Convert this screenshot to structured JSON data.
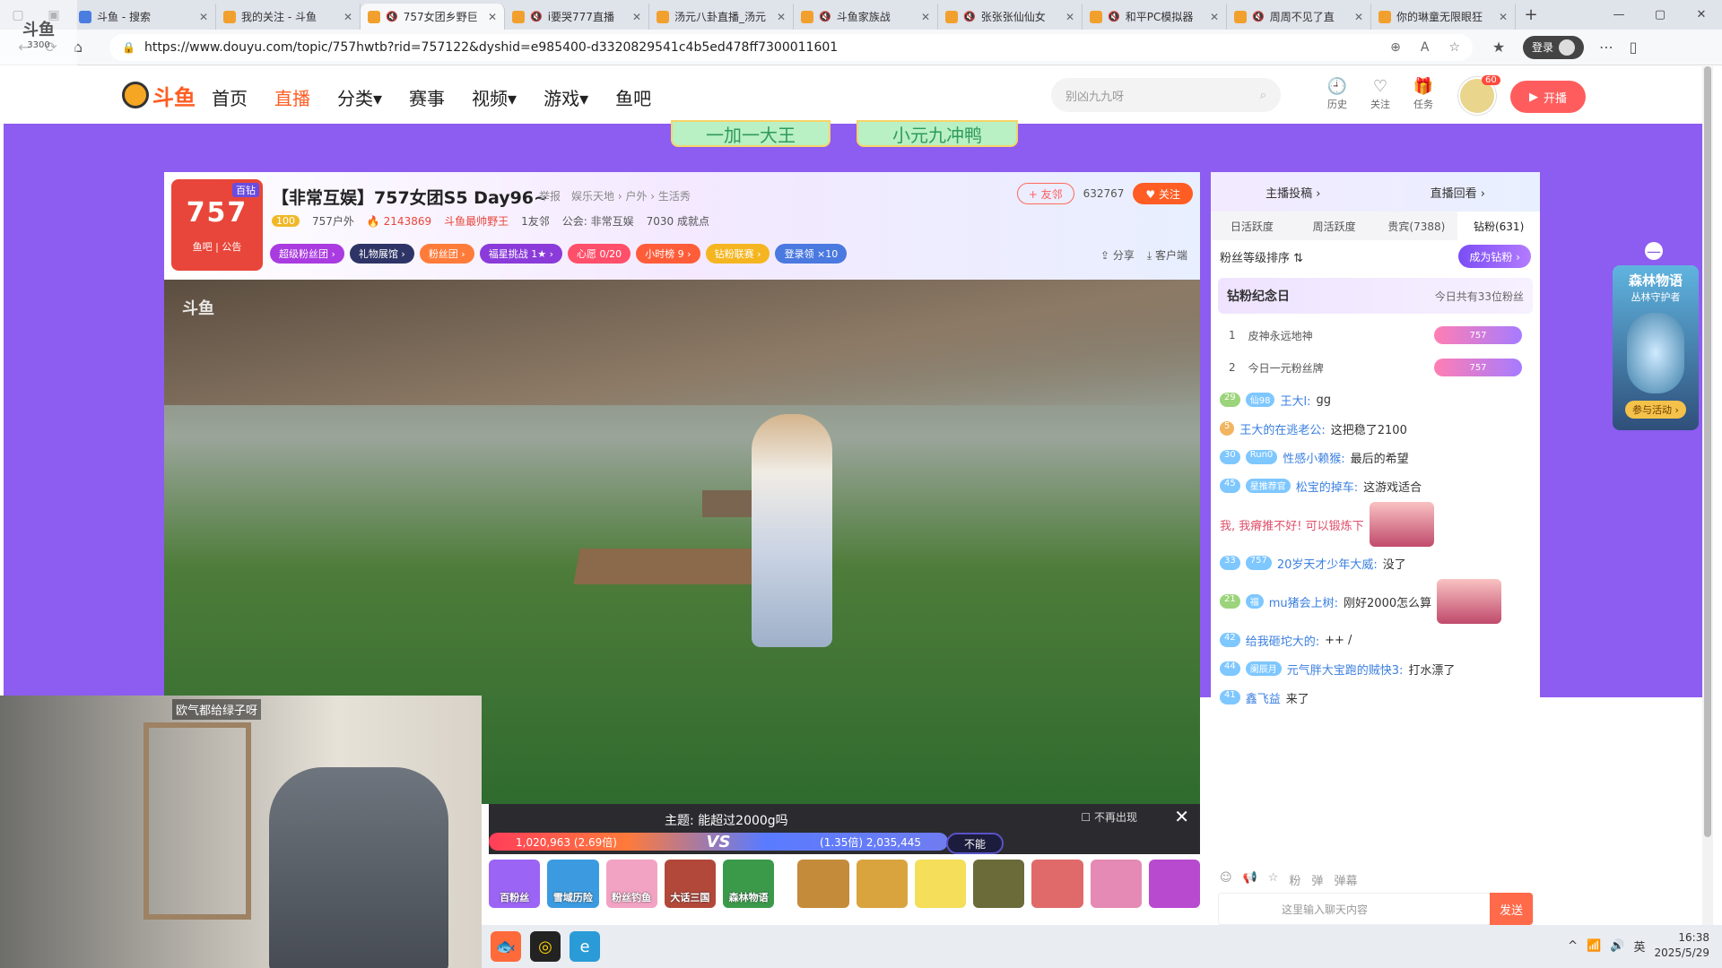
{
  "browser": {
    "tabs": [
      {
        "title": "斗鱼 - 搜索",
        "muted": false,
        "active": false
      },
      {
        "title": "我的关注 - 斗鱼",
        "muted": false,
        "active": false
      },
      {
        "title": "757女团乡野巨",
        "muted": true,
        "active": true
      },
      {
        "title": "i要哭777直播",
        "muted": true,
        "active": false
      },
      {
        "title": "汤元八卦直播_汤元",
        "muted": false,
        "active": false
      },
      {
        "title": "斗鱼家族战",
        "muted": true,
        "active": false
      },
      {
        "title": "张张张仙仙女",
        "muted": true,
        "active": false
      },
      {
        "title": "和平PC模拟器",
        "muted": true,
        "active": false
      },
      {
        "title": "周周不见了直",
        "muted": true,
        "active": false
      },
      {
        "title": "你的琳童无限眼狂",
        "muted": false,
        "active": false
      }
    ],
    "url": "https://www.douyu.com/topic/757hwtb?rid=757122&dyshid=e985400-d3320829541c4b5ed478ff7300011601",
    "login_label": "登录",
    "mini_logo": "斗鱼",
    "mini_logo_sub": "3300"
  },
  "header": {
    "logo_text": "斗鱼",
    "nav": [
      {
        "label": "首页",
        "active": false
      },
      {
        "label": "直播",
        "active": true
      },
      {
        "label": "分类▾",
        "active": false
      },
      {
        "label": "赛事",
        "active": false
      },
      {
        "label": "视频▾",
        "active": false
      },
      {
        "label": "游戏▾",
        "active": false
      },
      {
        "label": "鱼吧",
        "active": false
      }
    ],
    "search_placeholder": "别凶九九呀",
    "icons": [
      {
        "label": "历史",
        "icon": "history-icon",
        "glyph": "🕘"
      },
      {
        "label": "关注",
        "icon": "heart-icon",
        "glyph": "♡"
      },
      {
        "label": "任务",
        "icon": "gift-icon",
        "glyph": "🎁"
      }
    ],
    "avatar_badge": "60",
    "start_live_label": "开播"
  },
  "banners": [
    "一加一大王",
    "小元九冲鸭"
  ],
  "room": {
    "logo_num": "757",
    "logo_tag": "百钻",
    "logo_bottom": "鱼吧 | 公告",
    "title": "【非常互娱】757女团S5 Day96~",
    "tags": [
      "举报",
      "娱乐天地 › 户外 › 生活秀"
    ],
    "level": "100",
    "name": "757户外",
    "hot": "🔥 2143869",
    "honor": "斗鱼最帅野王",
    "friends": "1友邻",
    "guild": "公会: 非常互娱",
    "achievement": "7030 成就点",
    "pills": [
      {
        "label": "超级粉丝团 ›",
        "color": "#a93be0"
      },
      {
        "label": "礼物展馆 ›",
        "color": "#2e3566"
      },
      {
        "label": "粉丝团 ›",
        "color": "#ff7b3a"
      },
      {
        "label": "福星挑战  1★ ›",
        "color": "#8a3bd9"
      },
      {
        "label": "心愿  0/20",
        "color": "#ff4f6a"
      },
      {
        "label": "小时榜  9 ›",
        "color": "#ff5d3a"
      },
      {
        "label": "钻粉联赛 ›",
        "color": "#f5b521"
      },
      {
        "label": "登录领 ×10",
        "color": "#4a79e0"
      }
    ],
    "friend_btn": "+ 友邻",
    "fans_count": "632767",
    "follow_btn": "♥ 关注",
    "share": "分享",
    "client": "客户端",
    "watermark": "斗鱼"
  },
  "pk": {
    "topic": "主题: 能超过2000g吗",
    "no_show": "不再出现",
    "left_value": "1,020,963 (2.69倍)",
    "right_value": "(1.35倍) 2,035,445",
    "vs": "VS",
    "option": "不能"
  },
  "gifts": [
    {
      "label": "百粉丝",
      "color": "#9b64f5"
    },
    {
      "label": "雪域历险",
      "color": "#3c9be0"
    },
    {
      "label": "粉丝钓鱼",
      "color": "#f2a3c4"
    },
    {
      "label": "大话三国",
      "color": "#b2483a"
    },
    {
      "label": "森林物语",
      "color": "#3a9a4a"
    },
    {
      "label": "",
      "color": "#c48b3a"
    },
    {
      "label": "",
      "color": "#d9a43e"
    },
    {
      "label": "",
      "color": "#f4de5a"
    },
    {
      "label": "",
      "color": "#6b6b3a"
    },
    {
      "label": "",
      "color": "#e06a6a"
    },
    {
      "label": "",
      "color": "#e48ab4"
    },
    {
      "label": "",
      "color": "#b84ad0"
    }
  ],
  "side": {
    "top_tabs": [
      "主播投稿 ›",
      "直播回看 ›"
    ],
    "tabs": [
      {
        "label": "日活跃度",
        "active": false
      },
      {
        "label": "周活跃度",
        "active": false
      },
      {
        "label": "贵宾(7388)",
        "active": false
      },
      {
        "label": "钻粉(631)",
        "active": true
      }
    ],
    "rank_label": "粉丝等级排序 ⇅",
    "become_label": "成为钻粉 ›",
    "memo_title": "钻粉纪念日",
    "memo_sub": "今日共有33位粉丝",
    "fans": [
      {
        "rank": "1",
        "name": "皮神永远地神",
        "badge": "757"
      },
      {
        "rank": "2",
        "name": "今日一元粉丝牌",
        "badge": "757"
      }
    ],
    "messages": [
      {
        "lv": "29",
        "badge": "仙98",
        "name": "王大l:",
        "text": "gg",
        "style": "g"
      },
      {
        "lv": "5",
        "badge": "",
        "name": "王大的在逃老公:",
        "text": "这把稳了2100",
        "style": "o"
      },
      {
        "lv": "30",
        "badge": "Run0",
        "name": "性感小赖猴:",
        "text": "最后的希望",
        "style": "b"
      },
      {
        "lv": "45",
        "badge": "星推荐官",
        "name": "松宝的掉车:",
        "text": "这游戏适合",
        "style": "b"
      },
      {
        "lv": "",
        "badge": "",
        "name": "",
        "text": "我, 我瘠推不好! 可以锻炼下",
        "style": "r"
      },
      {
        "lv": "33",
        "badge": "757",
        "name": "20岁天才少年大威:",
        "text": "没了",
        "style": "b"
      },
      {
        "lv": "21",
        "badge": "福",
        "name": "mu猪会上树:",
        "text": "刚好2000怎么算",
        "style": "g"
      },
      {
        "lv": "42",
        "badge": "",
        "name": "给我砸坨大的:",
        "text": "++ /",
        "style": "b"
      },
      {
        "lv": "44",
        "badge": "阑辰月",
        "name": "元气胖大宝跑的贼快3:",
        "text": "打水漂了",
        "style": "b"
      },
      {
        "lv": "41",
        "badge": "",
        "name": "鑫飞益",
        "text": "来了",
        "style": "b"
      }
    ],
    "input_placeholder": "这里输入聊天内容",
    "send_label": "发送",
    "tools": [
      "☺",
      "📢",
      "☆",
      "粉",
      "弹",
      "弹幕"
    ]
  },
  "ad": {
    "title": "森林物语",
    "sub": "丛林守护者",
    "btn": "参与活动 ›"
  },
  "webcam": {
    "label": "欧气都给绿子呀"
  },
  "taskbar": {
    "time": "16:38",
    "date": "2025/5/29",
    "ime": "英"
  }
}
